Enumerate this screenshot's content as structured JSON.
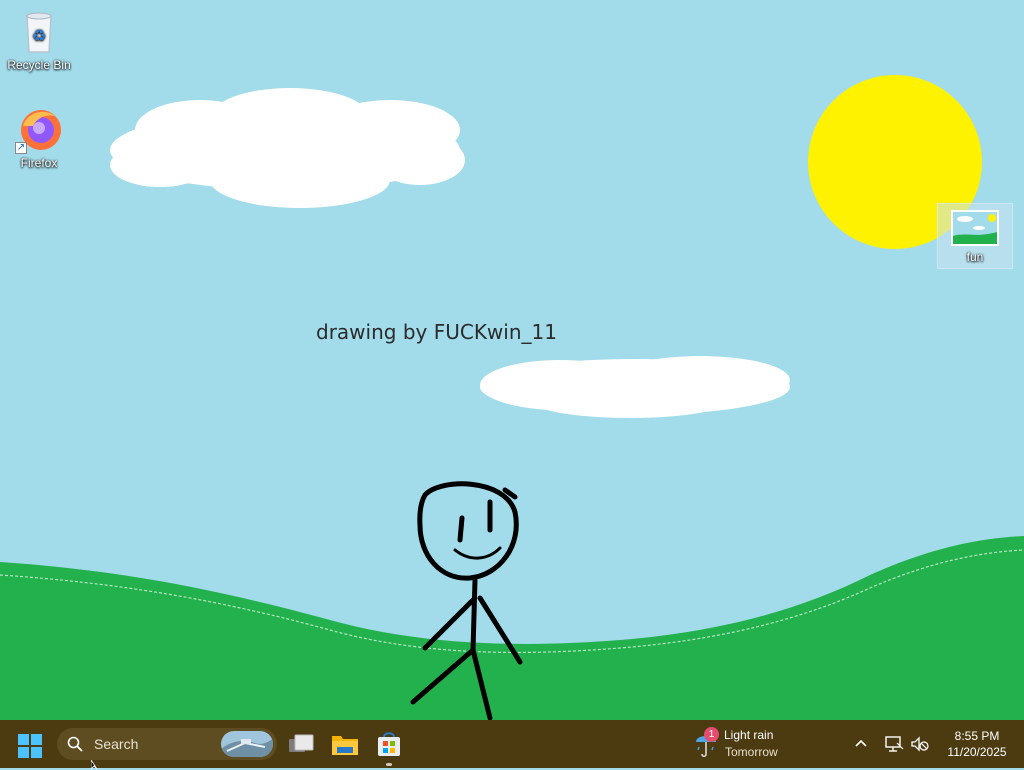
{
  "desktop": {
    "icons": [
      {
        "label": "Recycle Bin",
        "icon": "recycle-bin-icon"
      },
      {
        "label": "Firefox",
        "icon": "firefox-icon"
      },
      {
        "label": "fun",
        "icon": "image-file-icon"
      }
    ],
    "wallpaper": {
      "caption": "drawing by FUCKwin_11",
      "sky_color": "#a2dbea",
      "grass_color": "#22b14c",
      "sun_color": "#fff200",
      "cloud_color": "#ffffff"
    }
  },
  "taskbar": {
    "background": "#4c3b10",
    "start_icon": "windows-start-icon",
    "search_placeholder": "Search",
    "apps": [
      {
        "name": "Task View",
        "icon": "task-view-icon"
      },
      {
        "name": "File Explorer",
        "icon": "folder-icon"
      },
      {
        "name": "Microsoft Store",
        "icon": "store-icon"
      }
    ],
    "weather": {
      "badge": "1",
      "line1": "Light rain",
      "line2": "Tomorrow",
      "icon": "umbrella-rain-icon"
    },
    "tray": {
      "chevron_icon": "chevron-up-icon",
      "network_icon": "network-icon",
      "volume_icon": "volume-muted-icon"
    },
    "clock": {
      "time": "8:55 PM",
      "date": "11/20/2025"
    }
  }
}
